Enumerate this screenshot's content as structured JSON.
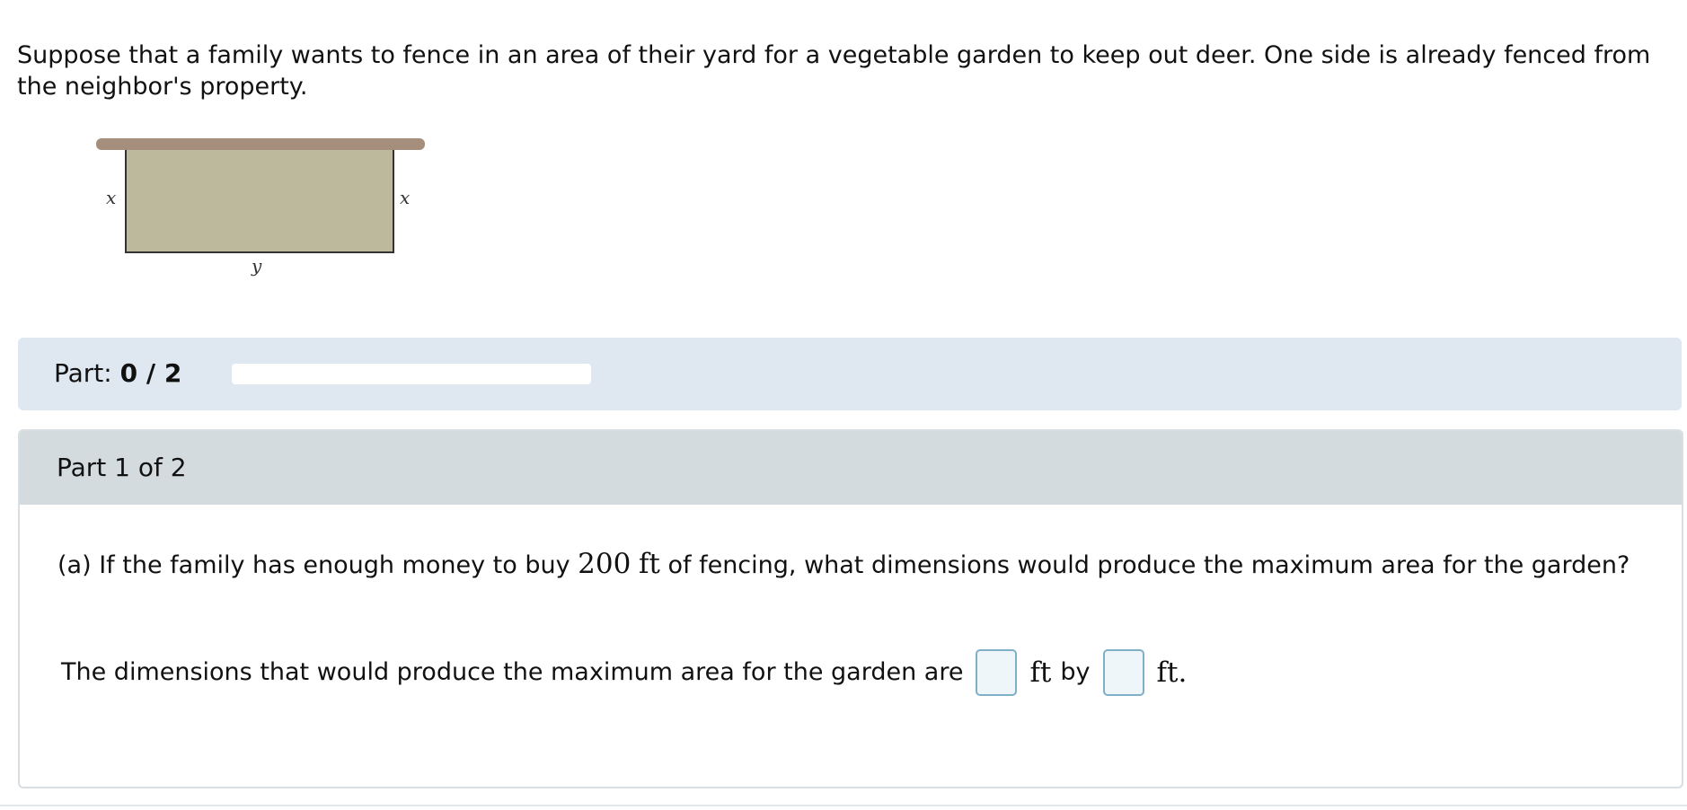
{
  "intro_text": "Suppose that a family wants to fence in an area of their yard for a vegetable garden to keep out deer. One side is already fenced from the neighbor's property.",
  "figure": {
    "side_left_label": "x",
    "side_right_label": "x",
    "bottom_label": "y",
    "colors": {
      "fence": "#a58f7c",
      "garden": "#bdb99c",
      "outline": "#333333"
    }
  },
  "progress": {
    "label": "Part:",
    "count": "0 / 2",
    "fraction": 0
  },
  "part": {
    "header": "Part 1 of 2",
    "question_prefix": "(a) If the family has enough money to buy",
    "question_amount": "200",
    "question_unit": "ft",
    "question_suffix": "of fencing, what dimensions would produce the maximum area for the garden?",
    "answer_prefix": "The dimensions that would produce the maximum area for the garden are",
    "answer_mid_unit": "ft",
    "answer_by": "by",
    "answer_end_unit": "ft."
  },
  "inputs": {
    "width_value": "",
    "length_value": ""
  }
}
